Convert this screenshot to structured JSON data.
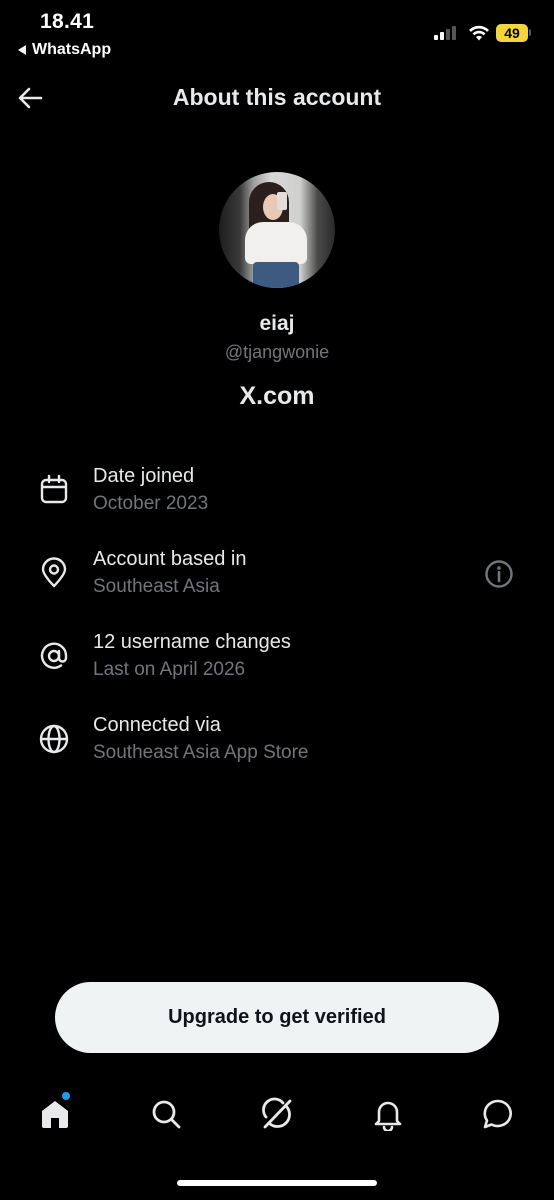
{
  "status_bar": {
    "time": "18.41",
    "back_app": "WhatsApp",
    "battery": "49"
  },
  "header": {
    "title": "About this account"
  },
  "profile": {
    "name": "eiaj",
    "handle": "@tjangwonie",
    "platform": "X.com"
  },
  "details": [
    {
      "icon": "calendar-icon",
      "title": "Date joined",
      "subtitle": "October 2023"
    },
    {
      "icon": "location-pin-icon",
      "title": "Account based in",
      "subtitle": "Southeast Asia"
    },
    {
      "icon": "at-sign-icon",
      "title": "12 username changes",
      "subtitle": "Last on April 2026"
    },
    {
      "icon": "globe-icon",
      "title": "Connected via",
      "subtitle": "Southeast Asia App Store"
    }
  ],
  "cta": {
    "label": "Upgrade to get verified"
  },
  "tab_bar": [
    "home-icon",
    "search-icon",
    "grok-icon",
    "notifications-icon",
    "messages-icon"
  ],
  "colors": {
    "background": "#000000",
    "primary_text": "#e7e9ea",
    "secondary_text": "#71767b",
    "accent": "#1d9bf0",
    "button_bg": "#eff3f4"
  }
}
